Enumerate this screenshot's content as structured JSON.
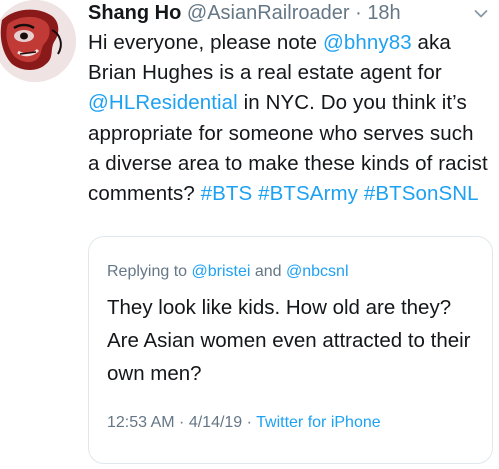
{
  "tweet": {
    "display_name": "Shang Ho",
    "handle": "@AsianRailroader",
    "separator": "·",
    "time": "18h",
    "body": {
      "part1": "Hi everyone, please note ",
      "mention1": "@bhny83",
      "part2": " aka Brian Hughes is a real estate agent for ",
      "mention2": "@HLResidential",
      "part3": " in NYC. Do you think it’s appropriate for someone who serves such a diverse area to make these kinds of racist comments? ",
      "hashtag1": "#BTS",
      "space1": " ",
      "hashtag2": "#BTSArmy",
      "space2": " ",
      "hashtag3": "#BTSonSNL"
    },
    "menu_icon": "chevron-down-icon"
  },
  "quoted_tweet": {
    "replying_prefix": "Replying to ",
    "reply_user1": "@bristei",
    "reply_and": " and ",
    "reply_user2": "@nbcsnl",
    "text": "They look like kids. How old are they? Are Asian women even attracted to their own men?",
    "time": "12:53 AM · 4/14/19 · ",
    "source": "Twitter for iPhone"
  },
  "colors": {
    "link": "#1da1f2",
    "secondary_text": "#657786",
    "primary_text": "#14171a",
    "border": "#e1e8ed"
  }
}
